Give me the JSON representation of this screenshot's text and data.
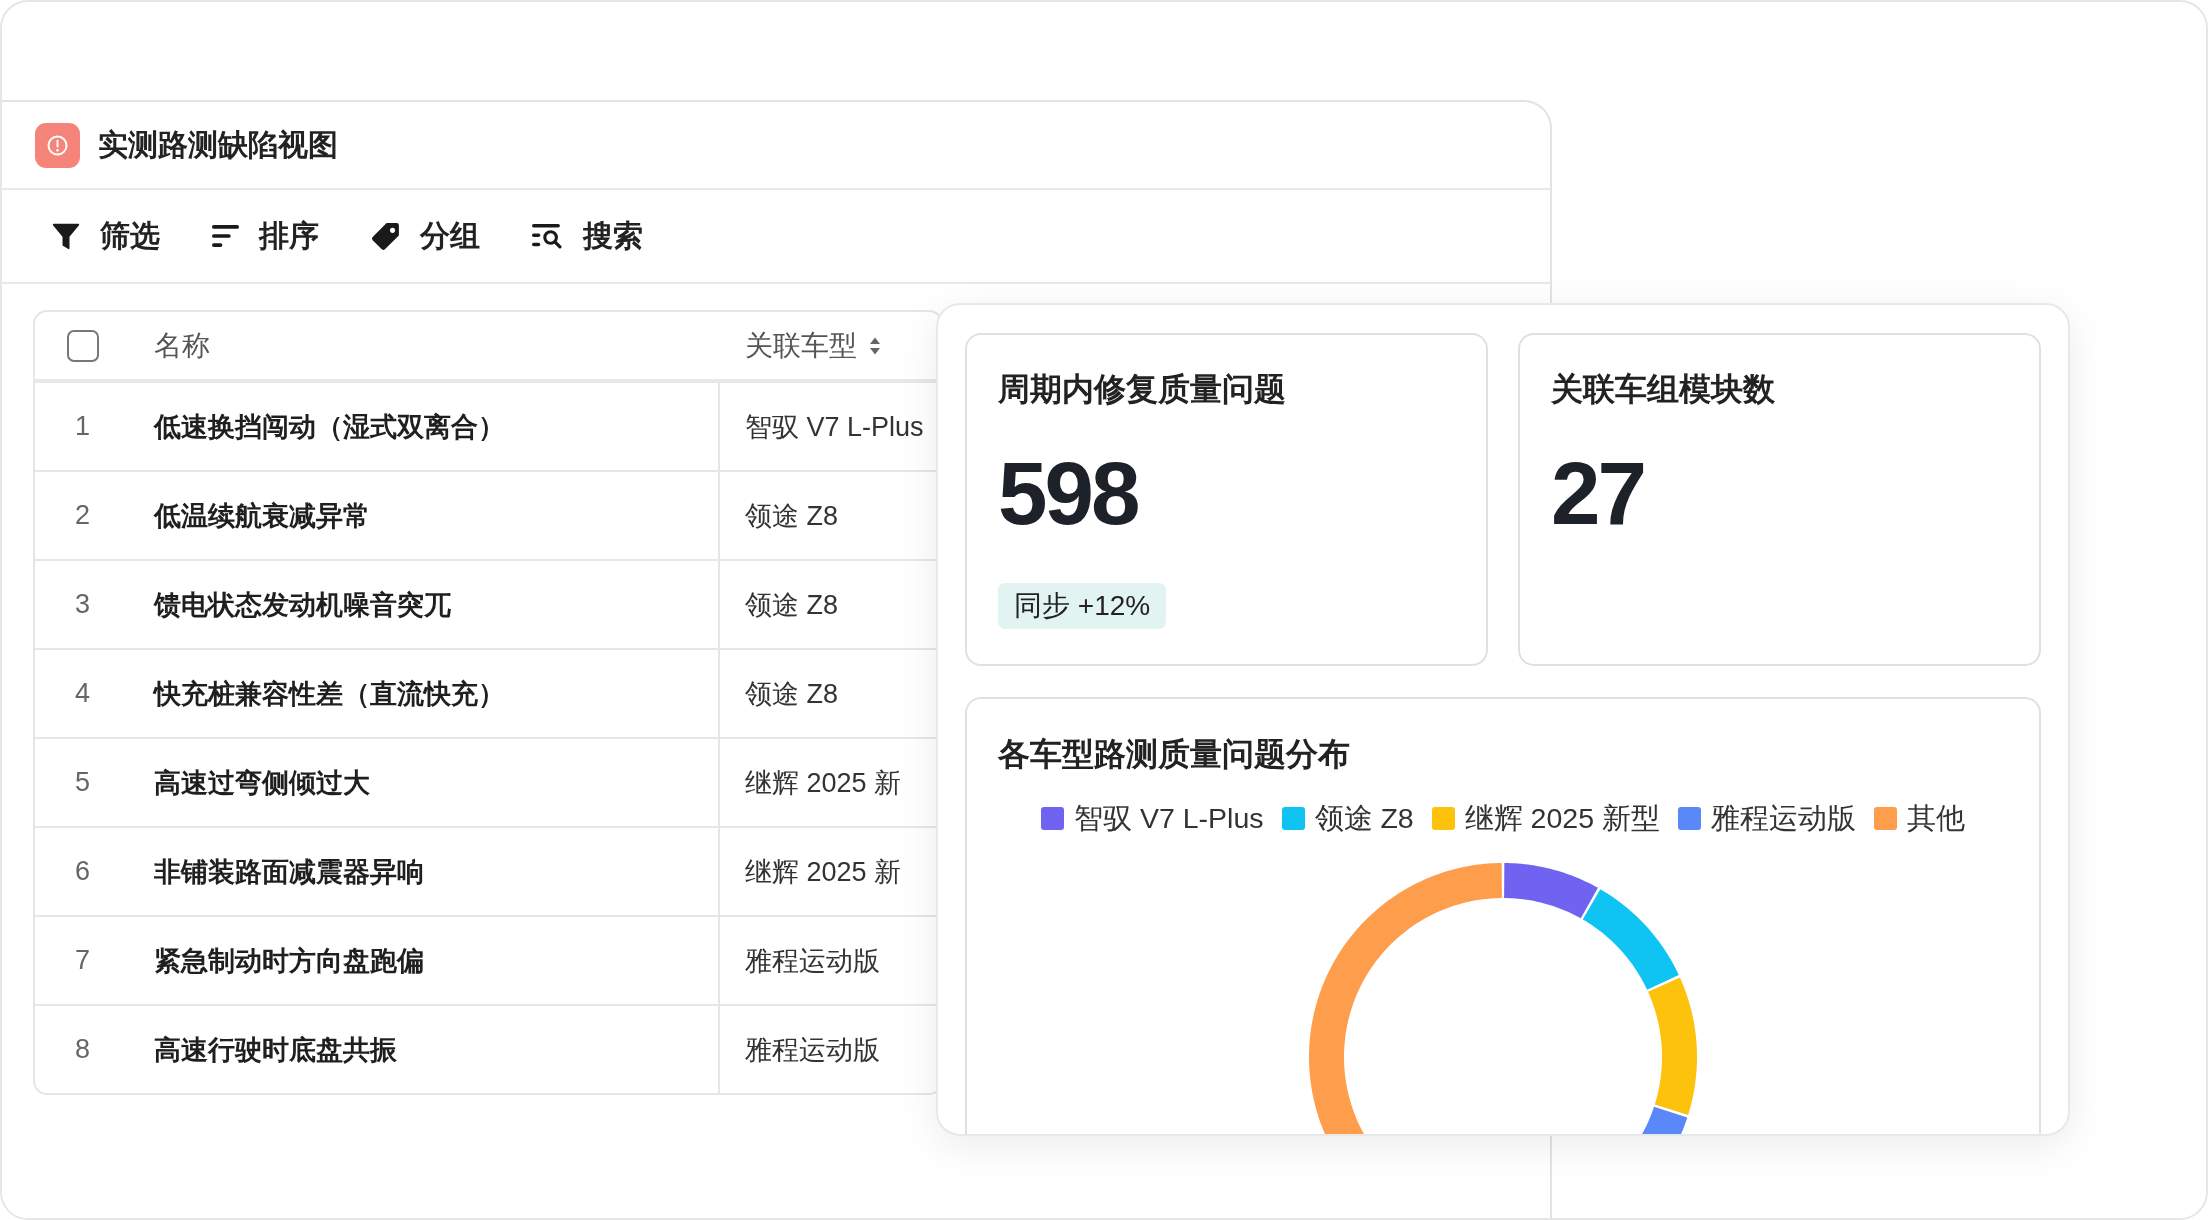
{
  "window": {
    "title": "实测路测缺陷视图"
  },
  "toolbar": [
    {
      "kind": "filter",
      "label": "筛选"
    },
    {
      "kind": "sort",
      "label": "排序"
    },
    {
      "kind": "group",
      "label": "分组"
    },
    {
      "kind": "search",
      "label": "搜索"
    }
  ],
  "table": {
    "select_all_checked": false,
    "columns": [
      {
        "label": "名称",
        "sortable": false
      },
      {
        "label": "关联车型",
        "sortable": true
      }
    ],
    "rows": [
      {
        "number": "1",
        "name": "低速换挡闯动（湿式双离合）",
        "model": "智驭 V7 L-Plus"
      },
      {
        "number": "2",
        "name": "低温续航衰减异常",
        "model": "领途 Z8"
      },
      {
        "number": "3",
        "name": "馈电状态发动机噪音突兀",
        "model": "领途 Z8"
      },
      {
        "number": "4",
        "name": "快充桩兼容性差（直流快充）",
        "model": "领途 Z8"
      },
      {
        "number": "5",
        "name": "高速过弯侧倾过大",
        "model": "继辉 2025 新"
      },
      {
        "number": "6",
        "name": "非铺装路面减震器异响",
        "model": "继辉 2025 新"
      },
      {
        "number": "7",
        "name": "紧急制动时方向盘跑偏",
        "model": "雅程运动版"
      },
      {
        "number": "8",
        "name": "高速行驶时底盘共振",
        "model": "雅程运动版"
      }
    ]
  },
  "overlay": {
    "stats": [
      {
        "title": "周期内修复质量问题",
        "value": "598",
        "badge": "同步 +12%"
      },
      {
        "title": "关联车组模块数",
        "value": "27"
      }
    ],
    "chart": {
      "title": "各车型路测质量问题分布",
      "legend": [
        {
          "label": "智驭 V7 L-Plus",
          "color": "#7163f2"
        },
        {
          "label": "领途 Z8",
          "color": "#0fc4f2"
        },
        {
          "label": "继辉 2025 新型",
          "color": "#fdc20c"
        },
        {
          "label": "雅程运动版",
          "color": "#5b88f8"
        },
        {
          "label": "其他",
          "color": "#fe9d4b"
        }
      ]
    }
  }
}
